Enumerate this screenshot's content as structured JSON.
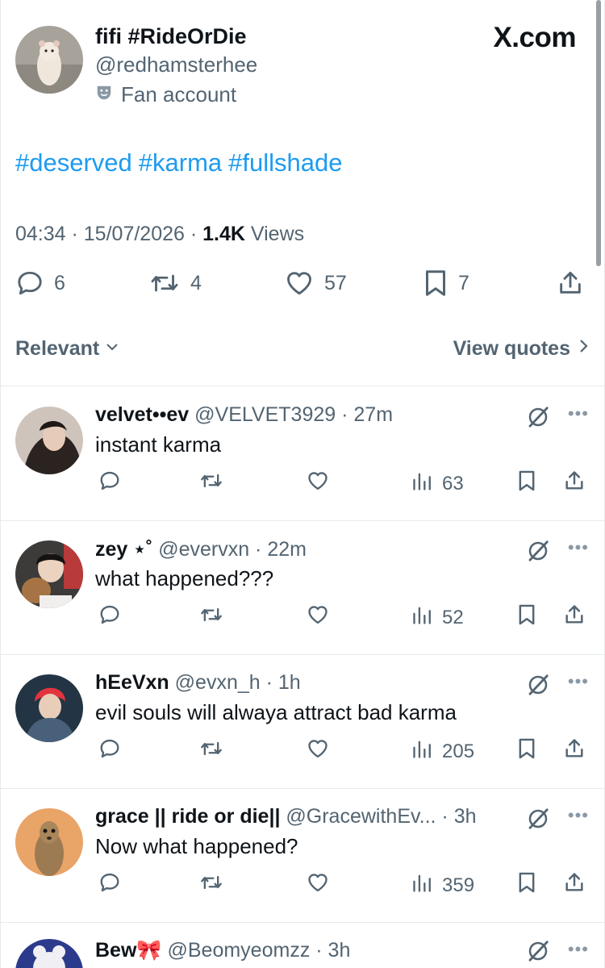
{
  "brand": "X.com",
  "tweet": {
    "display_name": "fifi #RideOrDie",
    "handle": "@redhamsterhee",
    "account_label": "Fan account",
    "hashtags": [
      "#deserved",
      "#karma",
      "#fullshade"
    ],
    "time": "04:34",
    "date": "15/07/2026",
    "views_count": "1.4K",
    "views_label": "Views",
    "replies": "6",
    "reposts": "4",
    "likes": "57",
    "bookmarks": "7"
  },
  "tabs": {
    "sort_label": "Relevant",
    "quotes_label": "View quotes"
  },
  "replies": [
    {
      "name": "velvet••ev",
      "handle": "@VELVET3929",
      "time": "27m",
      "text": "instant karma",
      "views": "63"
    },
    {
      "name": "zey ⋆˚",
      "handle": "@evervxn",
      "time": "22m",
      "text": "what happened???",
      "views": "52"
    },
    {
      "name": "hEeVxn",
      "handle": "@evxn_h",
      "time": "1h",
      "text": "evil souls will alwaya attract bad karma",
      "views": "205"
    },
    {
      "name": "grace || ride or die||",
      "handle": "@GracewithEv...",
      "time": "3h",
      "text": "Now what happened?",
      "views": "359"
    },
    {
      "name": "Bew🎀",
      "handle": "@Beomyeomzz",
      "time": "3h",
      "text": "",
      "views": ""
    }
  ],
  "colors": {
    "accent": "#1d9bf0",
    "text": "#0f1419",
    "muted": "#536471",
    "border": "#e6e9ec"
  }
}
